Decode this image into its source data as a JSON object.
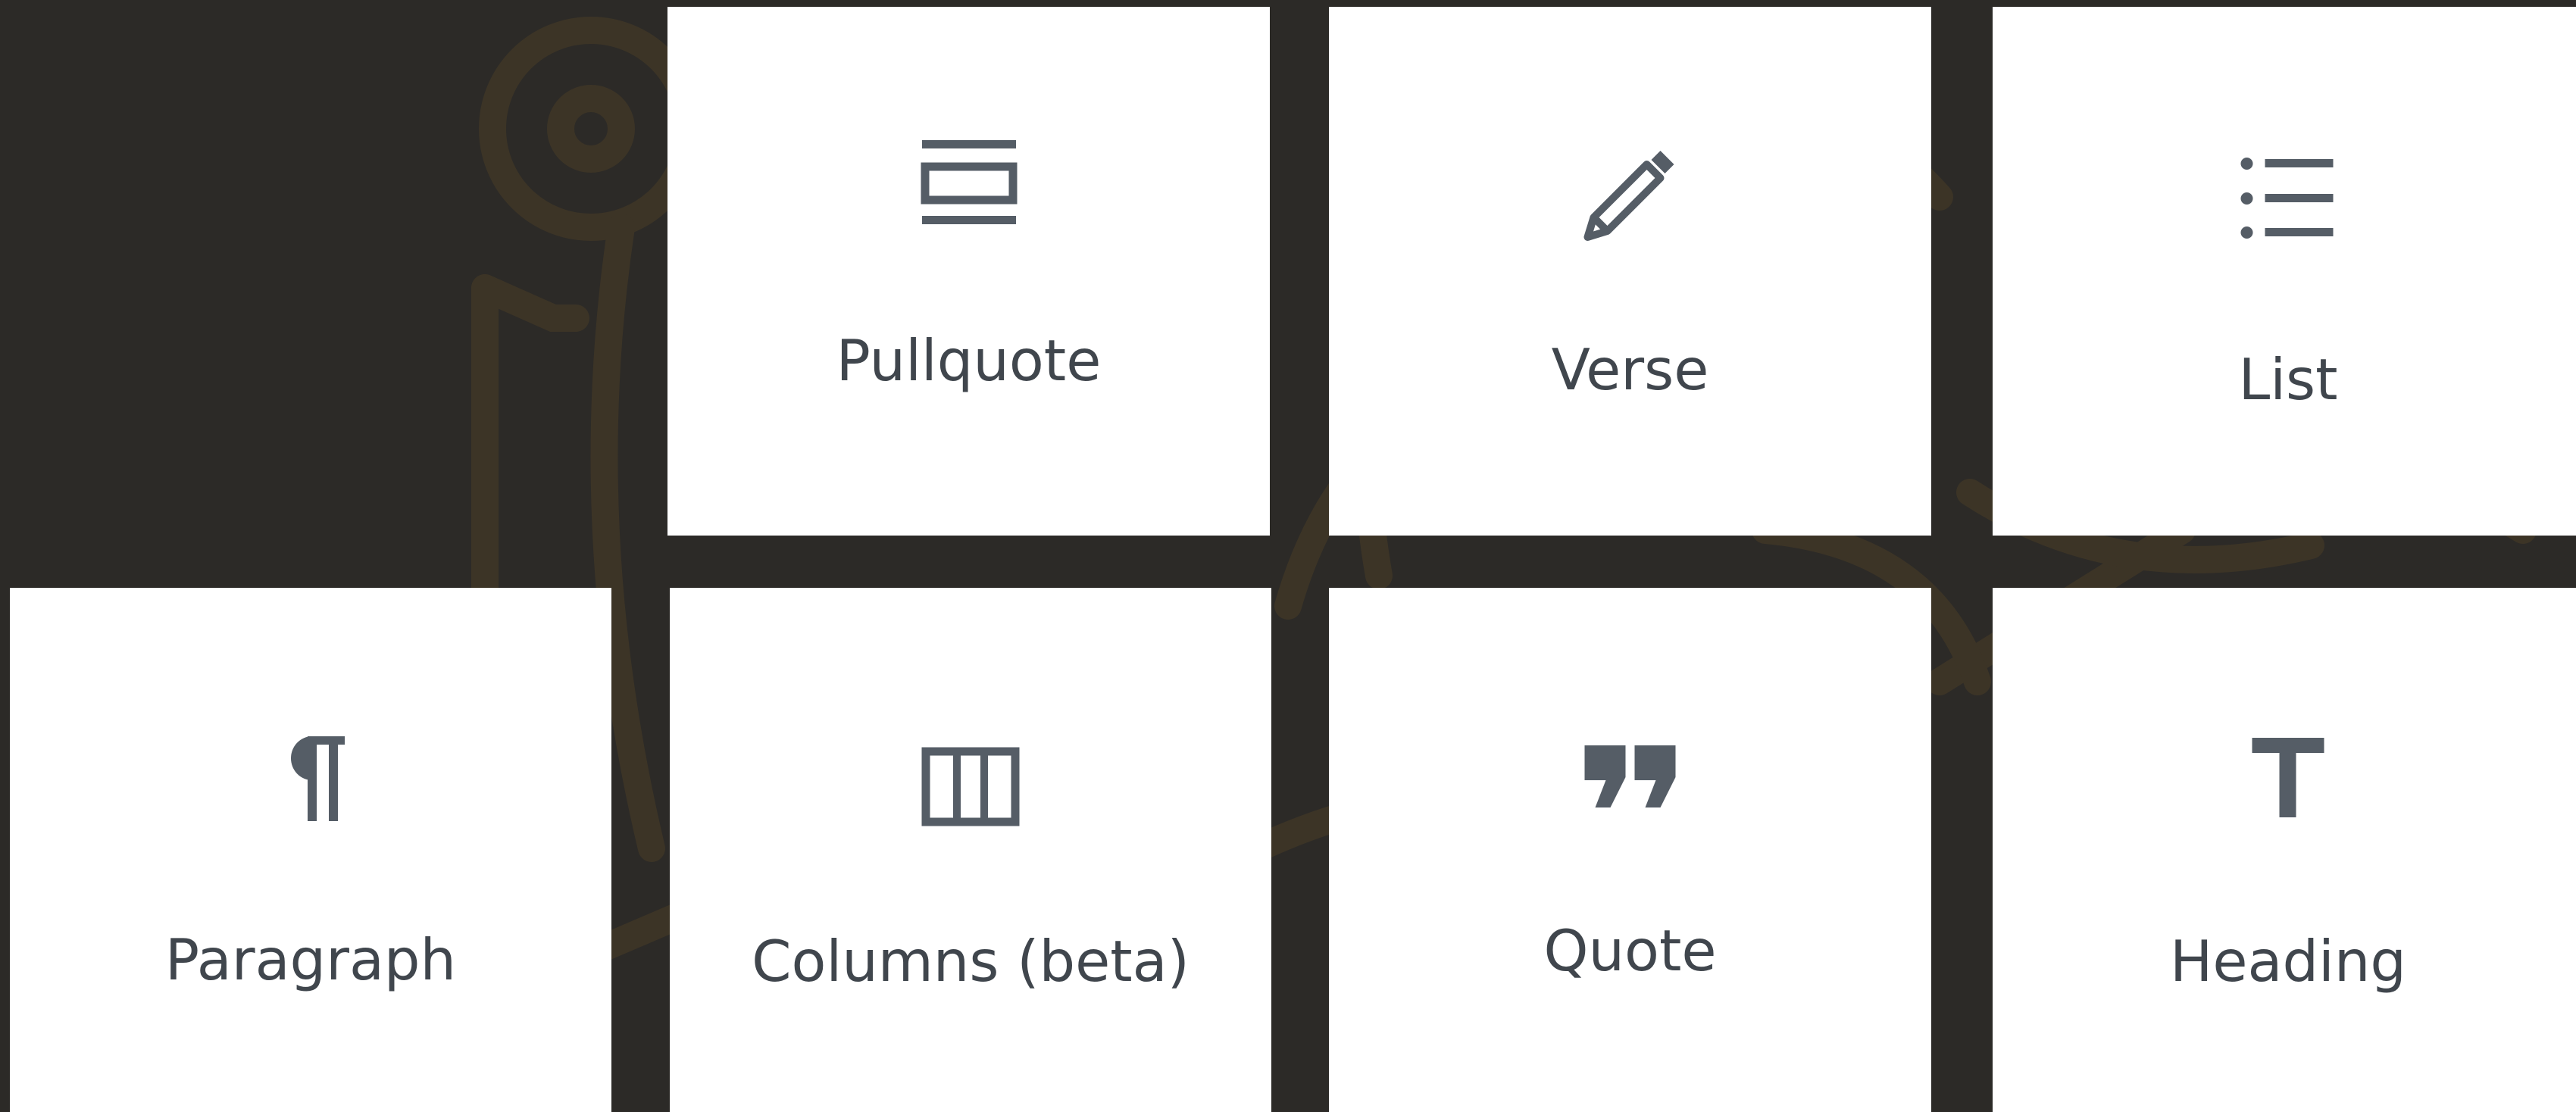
{
  "colors": {
    "background": "#2c2a27",
    "ornament": "#3c3426",
    "tile": "#ffffff",
    "icon": "#555d66",
    "text": "#40464d"
  },
  "blocks": [
    {
      "label": "Pullquote",
      "icon": "pullquote-icon"
    },
    {
      "label": "Verse",
      "icon": "pencil-icon"
    },
    {
      "label": "List",
      "icon": "list-icon"
    },
    {
      "label": "Paragraph",
      "icon": "paragraph-icon"
    },
    {
      "label": "Columns (beta)",
      "icon": "columns-icon"
    },
    {
      "label": "Quote",
      "icon": "quote-icon"
    },
    {
      "label": "Heading",
      "icon": "heading-icon"
    }
  ]
}
